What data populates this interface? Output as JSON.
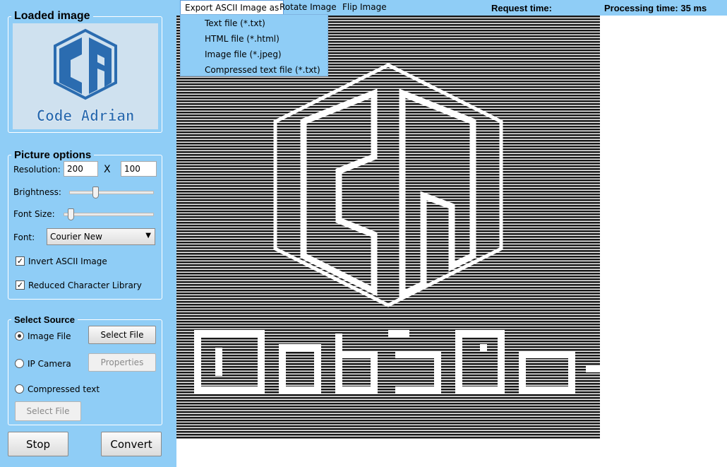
{
  "loaded_image": {
    "title": "Loaded image",
    "logo_text": "Code Adrian"
  },
  "picture_options": {
    "title": "Picture options",
    "resolution_label": "Resolution:",
    "resolution_width": "200",
    "resolution_separator": "X",
    "resolution_height": "100",
    "brightness_label": "Brightness:",
    "brightness_level": 0.3,
    "font_size_label": "Font Size:",
    "font_size_level": 0.05,
    "font_label": "Font:",
    "font_value": "Courier New",
    "invert_label": "Invert ASCII Image",
    "invert_checked": true,
    "reduced_label": "Reduced Character Library",
    "reduced_checked": true
  },
  "select_source": {
    "title": "Select Source",
    "image_file_label": "Image File",
    "image_file_selected": true,
    "select_file_button": "Select File",
    "ip_camera_label": "IP Camera",
    "properties_button": "Properties",
    "compressed_text_label": "Compressed text",
    "select_file_button_2": "Select File"
  },
  "actions": {
    "stop": "Stop",
    "convert": "Convert"
  },
  "menubar": {
    "export_label": "Export ASCII Image as",
    "rotate_label": "Rotate Image",
    "flip_label": "Flip Image",
    "request_time": "Request time:",
    "processing_time": "Processing time: 35 ms"
  },
  "export_menu": {
    "items": [
      "Text file (*.txt)",
      "HTML file (*.html)",
      "Image file (*.jpeg)",
      "Compressed text file (*.txt)"
    ]
  },
  "colors": {
    "panel_bg": "#8fcdf6",
    "logo_blue": "#2b6cb0"
  }
}
